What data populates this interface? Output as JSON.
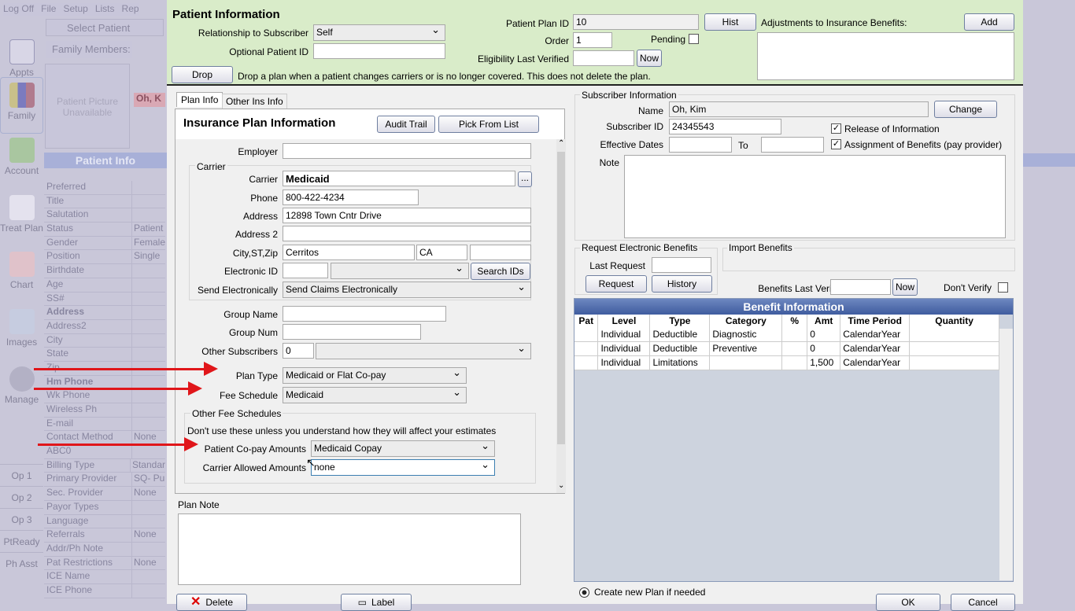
{
  "bg": {
    "menu": [
      "Log Off",
      "File",
      "Setup",
      "Lists",
      "Rep"
    ],
    "select_patient": "Select Patient",
    "family_members": "Family Members:",
    "picture": "Patient Picture Unavailable",
    "patient_name": "Oh, K",
    "patient_info_header": "Patient Info",
    "nav": [
      "Appts",
      "Family",
      "Account",
      "Treat Plan",
      "Chart",
      "Images",
      "Manage"
    ],
    "ops": [
      "Op 1",
      "Op 2",
      "Op 3",
      "PtReady",
      "Ph Asst"
    ],
    "rows": [
      [
        "Preferred",
        ""
      ],
      [
        "Title",
        ""
      ],
      [
        "Salutation",
        ""
      ],
      [
        "Status",
        "Patient"
      ],
      [
        "Gender",
        "Female"
      ],
      [
        "Position",
        "Single"
      ],
      [
        "Birthdate",
        ""
      ],
      [
        "Age",
        ""
      ],
      [
        "SS#",
        ""
      ],
      [
        "Address",
        ""
      ],
      [
        "Address2",
        ""
      ],
      [
        "City",
        ""
      ],
      [
        "State",
        ""
      ],
      [
        "Zip",
        ""
      ],
      [
        "Hm Phone",
        ""
      ],
      [
        "Wk Phone",
        ""
      ],
      [
        "Wireless Ph",
        ""
      ],
      [
        "E-mail",
        ""
      ],
      [
        "Contact Method",
        "None"
      ],
      [
        "ABC0",
        ""
      ],
      [
        "Billing Type",
        "Standar"
      ],
      [
        "Primary Provider",
        "SQ- Pu"
      ],
      [
        "Sec. Provider",
        "None"
      ],
      [
        "Payor Types",
        ""
      ],
      [
        "Language",
        ""
      ],
      [
        "Referrals",
        "None"
      ],
      [
        "Addr/Ph Note",
        ""
      ],
      [
        "Pat Restrictions",
        "None"
      ],
      [
        "ICE Name",
        ""
      ],
      [
        "ICE Phone",
        ""
      ]
    ]
  },
  "top": {
    "title": "Patient Information",
    "relationship_label": "Relationship to Subscriber",
    "relationship": "Self",
    "optional_id_label": "Optional Patient ID",
    "optional_id": "",
    "plan_id_label": "Patient Plan ID",
    "plan_id": "10",
    "hist": "Hist",
    "order_label": "Order",
    "order": "1",
    "pending_label": "Pending",
    "elig_label": "Eligibility Last Verified",
    "elig": "",
    "now": "Now",
    "adjust_label": "Adjustments to Insurance Benefits:",
    "add": "Add",
    "drop": "Drop",
    "drop_note": "Drop a plan when a patient changes carriers or is no longer covered.  This does not delete the plan."
  },
  "left": {
    "tabs": [
      "Plan Info",
      "Other Ins Info"
    ],
    "heading": "Insurance Plan Information",
    "audit": "Audit Trail",
    "pick": "Pick From List",
    "employer_label": "Employer",
    "employer": "",
    "carrier_group": "Carrier",
    "carrier_label": "Carrier",
    "carrier": "Medicaid",
    "ellipsis": "...",
    "phone_label": "Phone",
    "phone": "800-422-4234",
    "address_label": "Address",
    "address": "12898 Town Cntr Drive",
    "address2_label": "Address 2",
    "address2": "",
    "csz_label": "City,ST,Zip",
    "city": "Cerritos",
    "state": "CA",
    "zip": "",
    "eid_label": "Electronic ID",
    "eid": "",
    "search_ids": "Search IDs",
    "send_label": "Send Electronically",
    "send": "Send Claims Electronically",
    "group_name_label": "Group Name",
    "group_name": "",
    "group_num_label": "Group Num",
    "group_num": "",
    "other_subs_label": "Other Subscribers",
    "other_subs": "0",
    "plan_type_label": "Plan Type",
    "plan_type": "Medicaid or Flat Co-pay",
    "fee_label": "Fee Schedule",
    "fee": "Medicaid",
    "other_fee_group": "Other Fee Schedules",
    "other_fee_note": "Don't use these unless you understand how they will affect your estimates",
    "copay_label": "Patient Co-pay Amounts",
    "copay": "Medicaid Copay",
    "allowed_label": "Carrier Allowed Amounts",
    "allowed": "none",
    "plan_note_label": "Plan Note",
    "plan_note": "",
    "delete": "Delete",
    "label": "Label"
  },
  "right": {
    "sub_group": "Subscriber Information",
    "name_label": "Name",
    "name": "Oh, Kim",
    "change": "Change",
    "sid_label": "Subscriber ID",
    "sid": "24345543",
    "release": "Release of Information",
    "release_checked": true,
    "assign": "Assignment of Benefits (pay provider)",
    "assign_checked": true,
    "eff_label": "Effective Dates",
    "eff_from": "",
    "to": "To",
    "eff_to": "",
    "note_label": "Note",
    "note": "",
    "reb_group": "Request Electronic Benefits",
    "last_req_label": "Last Request",
    "last_req": "",
    "request": "Request",
    "history": "History",
    "import_group": "Import Benefits",
    "blv_label": "Benefits Last Verified",
    "blv": "",
    "now": "Now",
    "dont_verify": "Don't Verify",
    "benefit_header": "Benefit Information",
    "columns": [
      "Pat",
      "Level",
      "Type",
      "Category",
      "%",
      "Amt",
      "Time Period",
      "Quantity"
    ],
    "rows": [
      [
        "",
        "Individual",
        "Deductible",
        "Diagnostic",
        "",
        "0",
        "CalendarYear",
        ""
      ],
      [
        "",
        "Individual",
        "Deductible",
        "Preventive",
        "",
        "0",
        "CalendarYear",
        ""
      ],
      [
        "",
        "Individual",
        "Limitations",
        "",
        "",
        "1,500",
        "CalendarYear",
        ""
      ]
    ],
    "create_new": "Create new Plan if needed",
    "ok": "OK",
    "cancel": "Cancel"
  },
  "colors": {
    "green": "#d9ecc9",
    "benefit_header": "#4a67a8",
    "arrow": "#e0161a"
  }
}
